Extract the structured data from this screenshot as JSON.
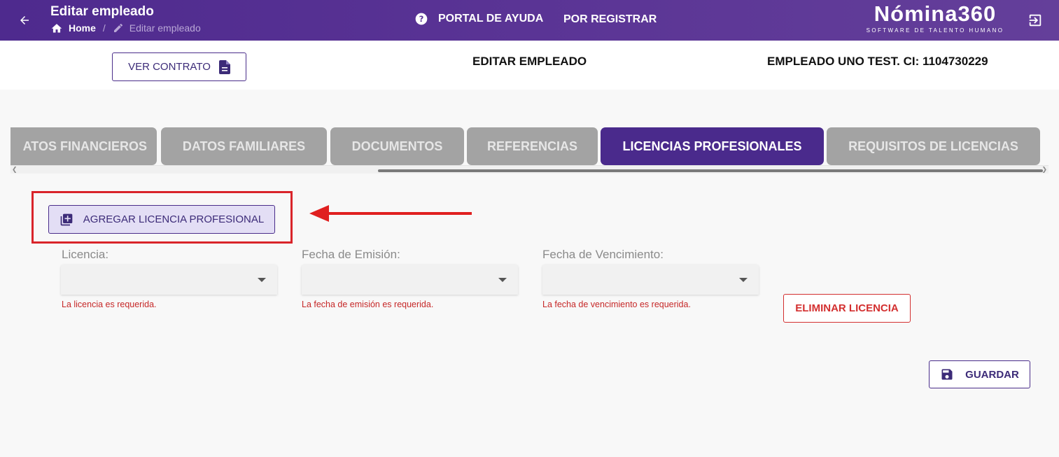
{
  "header": {
    "title": "Editar empleado",
    "breadcrumb": {
      "home": "Home",
      "separator": "/",
      "current": "Editar empleado"
    },
    "help_link": "PORTAL DE AYUDA",
    "register_link": "POR REGISTRAR",
    "brand_name": "Nómina360",
    "brand_tagline": "SOFTWARE DE TALENTO HUMANO"
  },
  "info": {
    "contract_button": "VER CONTRATO",
    "section_title": "EDITAR EMPLEADO",
    "employee": "EMPLEADO UNO TEST. CI: 1104730229"
  },
  "tabs": [
    {
      "label": "ATOS FINANCIEROS",
      "active": false
    },
    {
      "label": "DATOS FAMILIARES",
      "active": false
    },
    {
      "label": "DOCUMENTOS",
      "active": false
    },
    {
      "label": "REFERENCIAS",
      "active": false
    },
    {
      "label": "LICENCIAS PROFESIONALES",
      "active": true
    },
    {
      "label": "REQUISITOS DE LICENCIAS",
      "active": false
    }
  ],
  "add_button": "AGREGAR LICENCIA PROFESIONAL",
  "form": {
    "fields": [
      {
        "label": "Licencia:",
        "value": "",
        "error": "La licencia es requerida."
      },
      {
        "label": "Fecha de Emisión:",
        "value": "",
        "error": "La fecha de emisión es requerida."
      },
      {
        "label": "Fecha de Vencimiento:",
        "value": "",
        "error": "La fecha de vencimiento es requerida."
      }
    ],
    "delete_button": "ELIMINAR LICENCIA"
  },
  "save_button": "GUARDAR",
  "colors": {
    "primary": "#4a2a8c",
    "tab_inactive": "#a3a3a3",
    "error": "#d32f2f",
    "highlight": "#d9242a"
  }
}
